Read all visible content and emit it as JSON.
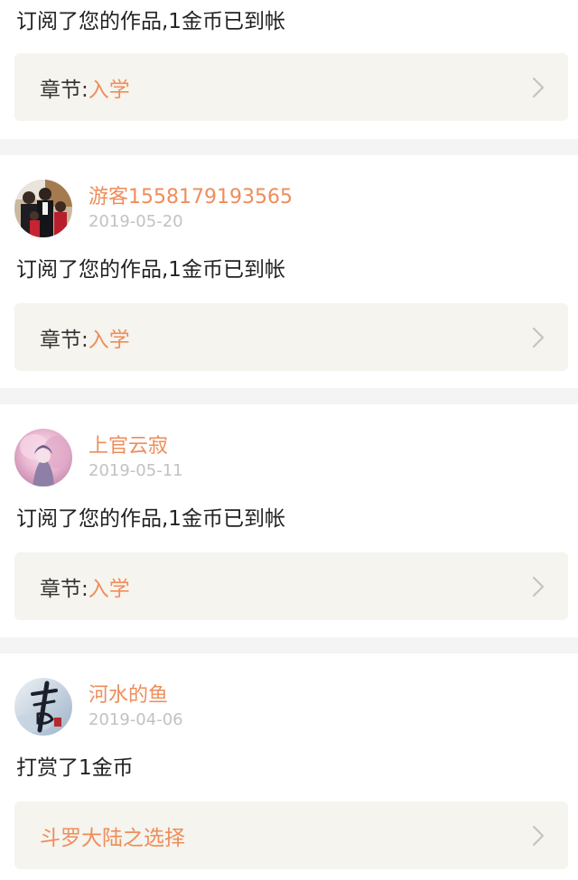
{
  "feed": [
    {
      "user": null,
      "message": "订阅了您的作品,1金币已到帐",
      "link": {
        "prefix": "章节:",
        "title": "入学"
      }
    },
    {
      "user": {
        "name": "游客1558179193565",
        "date": "2019-05-20"
      },
      "message": "订阅了您的作品,1金币已到帐",
      "link": {
        "prefix": "章节:",
        "title": "入学"
      }
    },
    {
      "user": {
        "name": "上官云寂",
        "date": "2019-05-11"
      },
      "message": "订阅了您的作品,1金币已到帐",
      "link": {
        "prefix": "章节:",
        "title": "入学"
      }
    },
    {
      "user": {
        "name": "河水的鱼",
        "date": "2019-04-06"
      },
      "message": "打赏了1金币",
      "link": {
        "prefix": "",
        "title": "斗罗大陆之选择"
      }
    }
  ],
  "colors": {
    "accent": "#ee8d5a",
    "date": "#c2c2c2",
    "text": "#222222",
    "link_box_bg": "#f5f4ee",
    "separator": "#f4f4f4"
  },
  "icons": {
    "link_arrow": "chevron-right-icon"
  }
}
